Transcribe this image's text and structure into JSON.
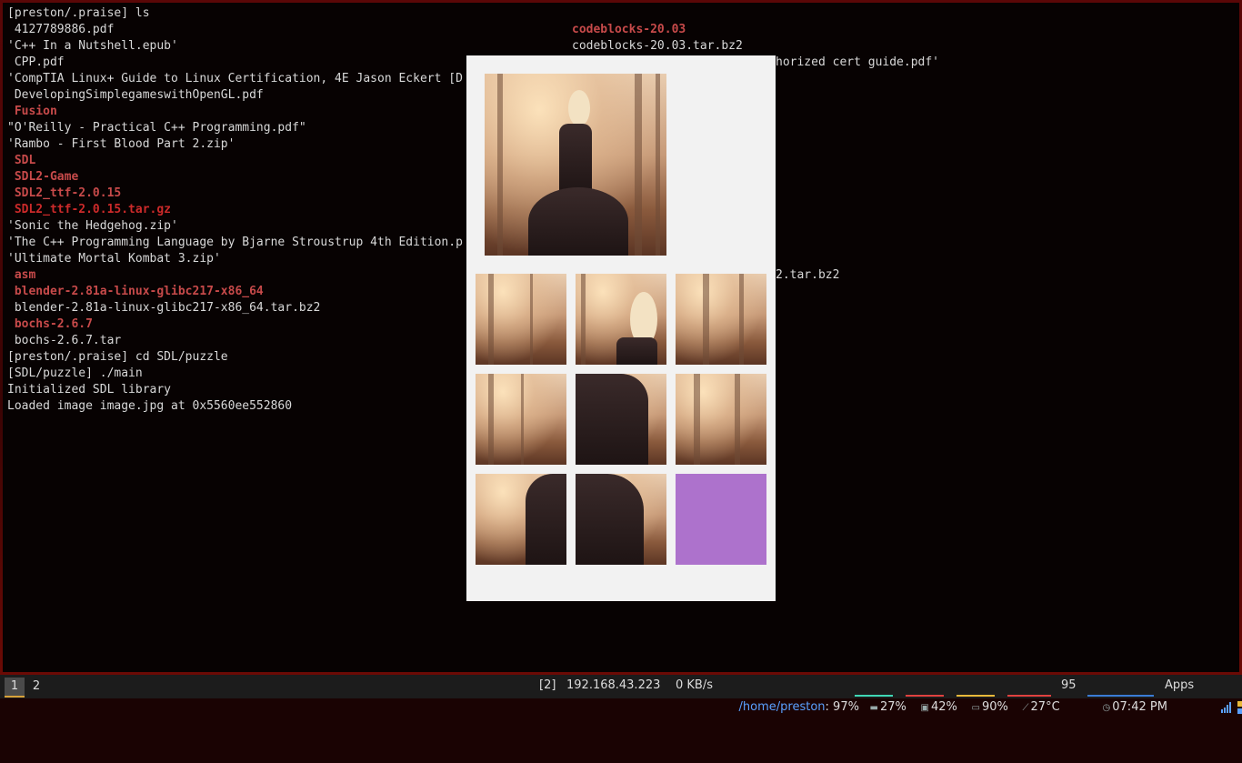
{
  "terminal": {
    "left_lines": [
      {
        "text": "[preston/.praise] ls",
        "style": "plain"
      },
      {
        "text": " 4127789886.pdf",
        "style": "plain"
      },
      {
        "text": "'C++ In a Nutshell.epub'",
        "style": "plain"
      },
      {
        "text": " CPP.pdf",
        "style": "plain"
      },
      {
        "text": "'CompTIA Linux+ Guide to Linux Certification, 4E Jason Eckert [D",
        "style": "plain"
      },
      {
        "text": " DevelopingSimplegameswithOpenGL.pdf",
        "style": "plain"
      },
      {
        "text": " Fusion",
        "style": "dir"
      },
      {
        "text": "\"O'Reilly - Practical C++ Programming.pdf\"",
        "style": "plain"
      },
      {
        "text": "'Rambo - First Blood Part 2.zip'",
        "style": "plain"
      },
      {
        "text": " SDL",
        "style": "dir"
      },
      {
        "text": " SDL2-Game",
        "style": "dir"
      },
      {
        "text": " SDL2_ttf-2.0.15",
        "style": "dir"
      },
      {
        "text": " SDL2_ttf-2.0.15.tar.gz",
        "style": "arch"
      },
      {
        "text": "'Sonic the Hedgehog.zip'",
        "style": "plain"
      },
      {
        "text": "'The C++ Programming Language by Bjarne Stroustrup 4th Edition.p",
        "style": "plain"
      },
      {
        "text": "'Ultimate Mortal Kombat 3.zip'",
        "style": "plain"
      },
      {
        "text": " asm",
        "style": "dir"
      },
      {
        "text": " blender-2.81a-linux-glibc217-x86_64",
        "style": "dir"
      },
      {
        "text": " blender-2.81a-linux-glibc217-x86_64.tar.bz2",
        "style": "plain"
      },
      {
        "text": " bochs-2.6.7",
        "style": "dir"
      },
      {
        "text": " bochs-2.6.7.tar",
        "style": "plain"
      },
      {
        "text": "[preston/.praise] cd SDL/puzzle",
        "style": "plain"
      },
      {
        "text": "[SDL/puzzle] ./main",
        "style": "plain"
      },
      {
        "text": "Initialized SDL library",
        "style": "plain"
      },
      {
        "text": "Loaded image image.jpg at 0x5560ee552860",
        "style": "plain"
      }
    ],
    "right_lines": [
      {
        "row": 1,
        "text": "codeblocks-20.03",
        "style": "dir",
        "col": 0
      },
      {
        "row": 2,
        "text": "codeblocks-20.03.tar.bz2",
        "style": "plain",
        "col": 0
      },
      {
        "row": 3,
        "text": "horized cert guide.pdf'",
        "style": "plain",
        "col": 1
      },
      {
        "row": 16,
        "text": "2.tar.bz2",
        "style": "plain",
        "col": 2
      }
    ]
  },
  "puzzle": {
    "preview_label": "image.jpg",
    "grid": [
      {
        "piece": "tile-1"
      },
      {
        "piece": "tile-2"
      },
      {
        "piece": "tile-3"
      },
      {
        "piece": "tile-4"
      },
      {
        "piece": "tile-5"
      },
      {
        "piece": "tile-6"
      },
      {
        "piece": "tile-7"
      },
      {
        "piece": "tile-8"
      },
      {
        "piece": "empty"
      }
    ],
    "empty_color": "#ad72cc"
  },
  "statusbar": {
    "workspaces": [
      "1",
      "2"
    ],
    "active_workspace": "1",
    "bracket": "[2]",
    "ip": "192.168.43.223",
    "net": "0 KB/s",
    "path": "/home/preston",
    "path_pct": ": 97%",
    "mem": "27%",
    "cpu": "42%",
    "battery": "90%",
    "temp": "27°C",
    "volume": "95",
    "time": "07:42 PM",
    "apps": "Apps",
    "colors": {
      "path": "#5aa0ff",
      "mem": "#3fd7b5",
      "cpu": "#e0413f",
      "battery": "#e8b83a",
      "temp": "#e0413f",
      "time": "#3a7bd5"
    },
    "icons": {
      "mem": "memory-icon",
      "cpu": "cpu-icon",
      "battery": "battery-icon",
      "temp": "thermometer-icon",
      "time": "clock-icon",
      "signal": "signal-icon",
      "tray": "tray-icon"
    }
  }
}
